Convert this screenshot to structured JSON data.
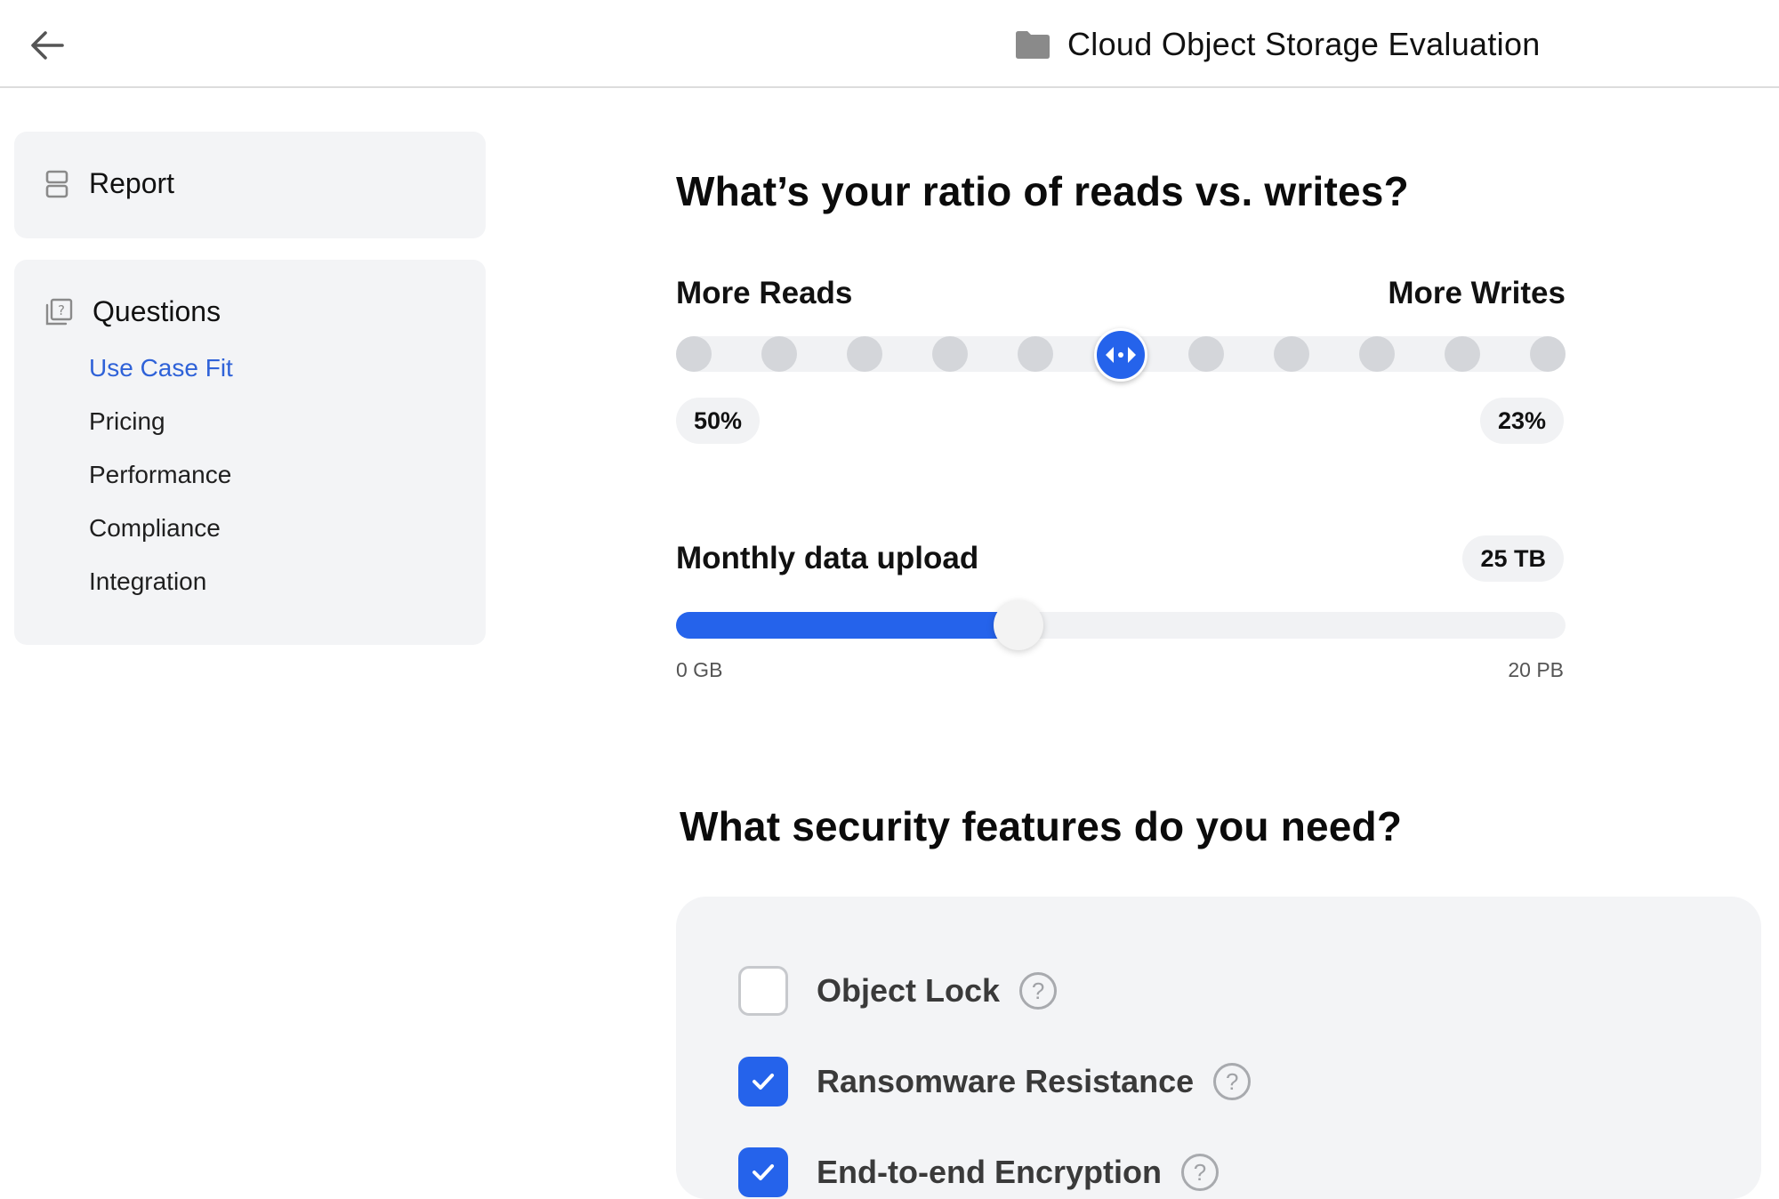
{
  "header": {
    "title": "Cloud Object Storage Evaluation",
    "back_icon": "arrow-left-icon",
    "folder_icon": "folder-icon"
  },
  "sidebar": {
    "report": {
      "label": "Report",
      "icon": "report-layout-icon"
    },
    "questions": {
      "label": "Questions",
      "icon": "question-box-icon",
      "items": [
        {
          "label": "Use Case Fit",
          "active": true
        },
        {
          "label": "Pricing"
        },
        {
          "label": "Performance"
        },
        {
          "label": "Compliance"
        },
        {
          "label": "Integration"
        }
      ]
    }
  },
  "reads_writes": {
    "heading": "What’s your ratio of reads vs. writes?",
    "left_label": "More Reads",
    "right_label": "More Writes",
    "steps": 11,
    "selected_step": 5,
    "left_value": "50%",
    "right_value": "23%"
  },
  "upload": {
    "label": "Monthly data upload",
    "value": "25 TB",
    "fill_fraction": 0.385,
    "min_label": "0 GB",
    "max_label": "20 PB"
  },
  "security": {
    "heading": "What security features do you need?",
    "features": [
      {
        "label": "Object Lock",
        "checked": false
      },
      {
        "label": "Ransomware Resistance",
        "checked": true
      },
      {
        "label": "End-to-end Encryption",
        "checked": true
      }
    ]
  },
  "colors": {
    "accent": "#2563eb",
    "active_link": "#2f62d8",
    "panel": "#f3f4f6"
  }
}
